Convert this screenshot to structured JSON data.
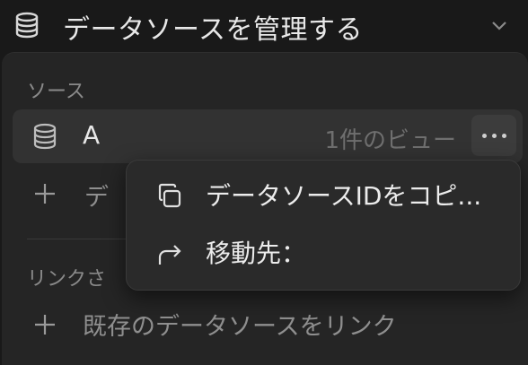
{
  "header": {
    "title": "データソースを管理する",
    "icon": "database-icon",
    "chevron": "chevron-down-icon"
  },
  "sources_section": {
    "label": "ソース",
    "items": [
      {
        "name": "A",
        "views": "1件のビュー",
        "icon": "database-icon"
      }
    ],
    "add_label": "デ"
  },
  "linked_section": {
    "label": "リンクさ",
    "link_existing_label": "既存のデータソースをリンク"
  },
  "context_menu": {
    "items": [
      {
        "label": "データソースIDをコピ...",
        "icon": "copy-icon"
      },
      {
        "label": "移動先：",
        "icon": "arrow-turn-right-icon"
      }
    ]
  },
  "colors": {
    "background": "#191919",
    "panel": "#252525",
    "row_selected": "#323232",
    "menu": "#2a2a2a"
  }
}
